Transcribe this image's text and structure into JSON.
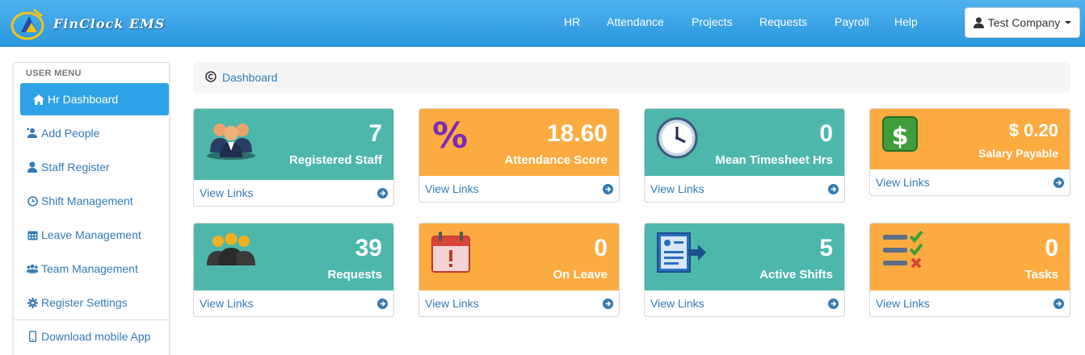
{
  "brand": {
    "name": "FinClock EMS"
  },
  "nav": {
    "links": [
      "HR",
      "Attendance",
      "Projects",
      "Requests",
      "Payroll",
      "Help"
    ],
    "company": "Test Company"
  },
  "sidebar": {
    "heading": "USER MENU",
    "items": [
      {
        "label": "Hr Dashboard",
        "icon": "home-icon"
      },
      {
        "label": "Add People",
        "icon": "add-user-icon"
      },
      {
        "label": "Staff Register",
        "icon": "user-icon"
      },
      {
        "label": "Shift Management",
        "icon": "clock-icon"
      },
      {
        "label": "Leave Management",
        "icon": "calendar-icon"
      },
      {
        "label": "Team Management",
        "icon": "users-icon"
      },
      {
        "label": "Register Settings",
        "icon": "gear-icon"
      },
      {
        "label": "Download mobile App",
        "icon": "mobile-icon"
      }
    ]
  },
  "breadcrumb": {
    "label": "Dashboard"
  },
  "tiles": [
    {
      "value": "7",
      "label": "Registered Staff",
      "link": "View Links",
      "icon": "staff-group-icon"
    },
    {
      "value": "18.60",
      "label": "Attendance Score",
      "link": "View Links",
      "icon": "percent-icon"
    },
    {
      "value": "0",
      "label": "Mean Timesheet Hrs",
      "link": "View Links",
      "icon": "wall-clock-icon"
    },
    {
      "value": "$ 0.20",
      "label": "Salary Payable",
      "link": "View Links",
      "icon": "dollar-icon"
    },
    {
      "value": "39",
      "label": "Requests",
      "link": "View Links",
      "icon": "people-icon"
    },
    {
      "value": "0",
      "label": "On Leave",
      "link": "View Links",
      "icon": "alert-calendar-icon"
    },
    {
      "value": "5",
      "label": "Active Shifts",
      "link": "View Links",
      "icon": "id-card-icon"
    },
    {
      "value": "0",
      "label": "Tasks",
      "link": "View Links",
      "icon": "checklist-icon"
    }
  ],
  "colors": {
    "navbar": "#2a97df",
    "teal": "#4db7ab",
    "orange": "#fcab40",
    "link": "#337ab7",
    "active": "#2ea2e6"
  }
}
